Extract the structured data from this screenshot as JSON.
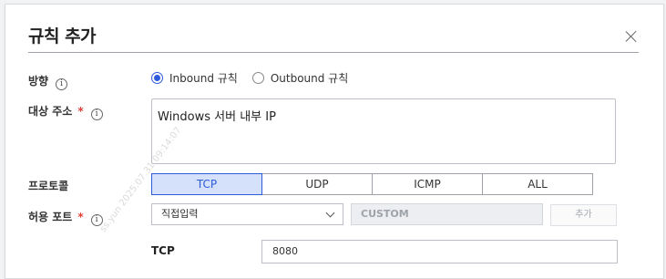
{
  "dialog": {
    "title": "규칙 추가",
    "watermark": "ss.yun 2025.07.31 09:14:07"
  },
  "direction": {
    "label": "방향",
    "options": [
      {
        "label": "Inbound 규칙",
        "checked": true
      },
      {
        "label": "Outbound 규칙",
        "checked": false
      }
    ]
  },
  "target": {
    "label": "대상 주소",
    "required_mark": "*",
    "value": "Windows 서버 내부 IP"
  },
  "protocol": {
    "label": "프로토콜",
    "options": [
      "TCP",
      "UDP",
      "ICMP",
      "ALL"
    ],
    "selected": "TCP"
  },
  "allowed_port": {
    "label": "허용 포트",
    "required_mark": "*",
    "select_value": "직접입력",
    "custom_value": "CUSTOM",
    "add_label": "추가",
    "entry_protocol": "TCP",
    "entry_value": "8080"
  },
  "info_glyph": "i",
  "colors": {
    "accent": "#2d5bdc",
    "required": "#e0413a",
    "selected_bg": "#d5e0fb"
  }
}
